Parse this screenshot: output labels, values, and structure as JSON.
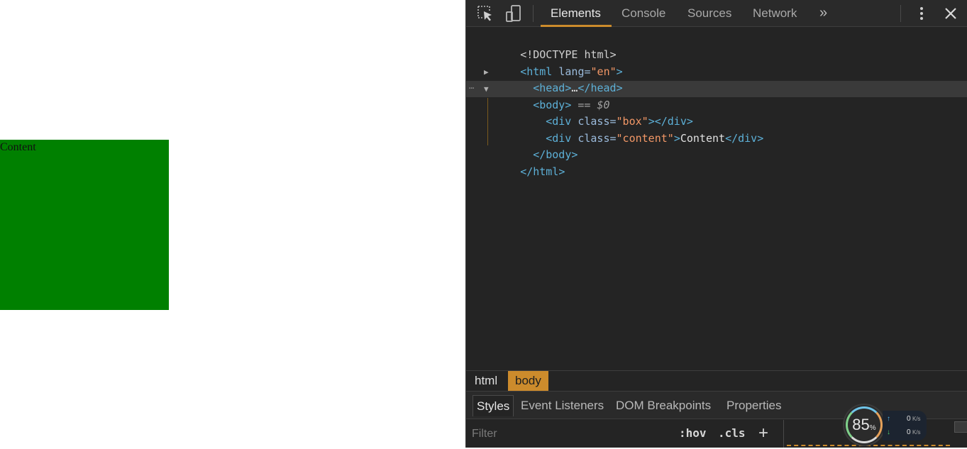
{
  "page": {
    "box_text": "Content",
    "box_color": "#008000"
  },
  "devtools": {
    "toolbar": {
      "inspect_icon": "inspect-element-icon",
      "device_icon": "device-toolbar-icon",
      "tabs": [
        "Elements",
        "Console",
        "Sources",
        "Network"
      ],
      "active_tab": "Elements",
      "more_tabs": "»",
      "menu_icon": "kebab-menu-icon",
      "close": "✕"
    },
    "dom": {
      "doctype": "<!DOCTYPE html>",
      "html_open": "<html",
      "html_attr": " lang=",
      "html_attr_val": "\"en\"",
      "html_close_bracket": ">",
      "head_open": "<head>",
      "head_ellipsis": "…",
      "head_close": "</head>",
      "body_open": "<body>",
      "body_marker": " == $0",
      "div1_open": "<div",
      "div1_attr": " class=",
      "div1_val": "\"box\"",
      "div1_end": "></div>",
      "div2_open": "<div",
      "div2_attr": " class=",
      "div2_val": "\"content\"",
      "div2_gt": ">",
      "div2_text": "Content",
      "div2_close": "</div>",
      "body_close": "</body>",
      "html_close": "</html>",
      "dots": "⋯"
    },
    "breadcrumbs": [
      "html",
      "body"
    ],
    "styles_tabs": [
      "Styles",
      "Event Listeners",
      "DOM Breakpoints",
      "Properties"
    ],
    "filter": {
      "placeholder": "Filter",
      "hov": ":hov",
      "cls": ".cls",
      "add": "+"
    },
    "accent": "#cc8b2c"
  },
  "net_widget": {
    "percent": "85",
    "percent_unit": "%",
    "up_value": "0",
    "down_value": "0",
    "unit": "K/s"
  }
}
